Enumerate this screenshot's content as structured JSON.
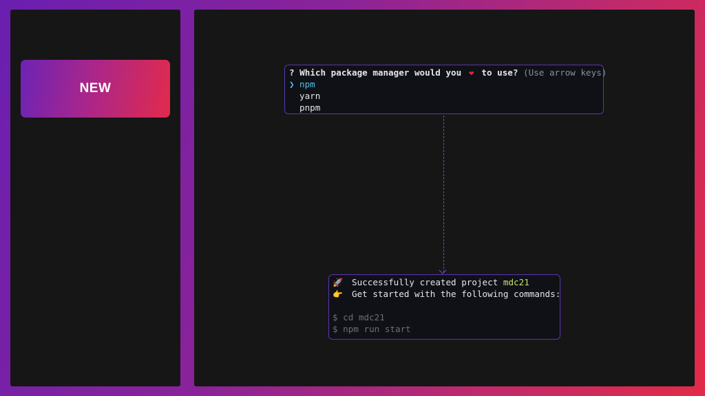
{
  "badge": {
    "label": "NEW"
  },
  "prompt": {
    "question_pre": "? Which package manager would you ",
    "heart_icon": "❤",
    "question_post": " to use?",
    "hint": " (Use arrow keys)",
    "pointer": "❯",
    "options": [
      "npm",
      "yarn",
      "pnpm"
    ],
    "selected_index": 0
  },
  "result": {
    "rocket_icon": "🚀",
    "line1_text": "Successfully created project ",
    "project_name": "mdc21",
    "hand_icon": "👉",
    "line2_text": "Get started with the following commands:",
    "commands": [
      "$ cd mdc21",
      "$ npm run start"
    ]
  },
  "colors": {
    "accent_purple": "#6a1fb0",
    "accent_red": "#e22a48",
    "selected_cyan": "#4fc1e9",
    "project_green": "#c9e06a",
    "border_purple": "#5a35b5"
  }
}
